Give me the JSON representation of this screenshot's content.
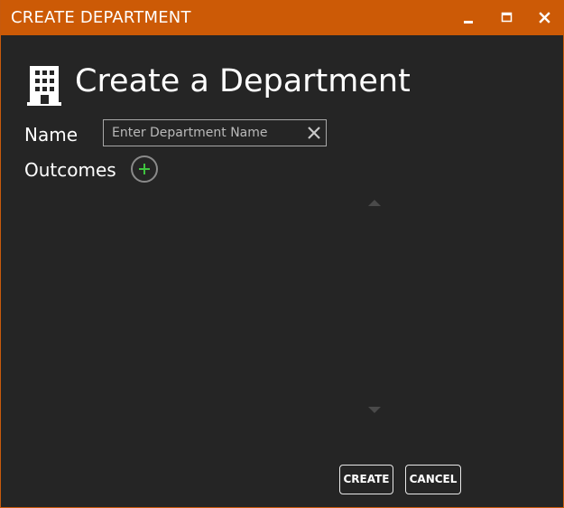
{
  "window": {
    "title": "CREATE DEPARTMENT",
    "accent_color": "#cc5a06",
    "background_color": "#252525",
    "controls": [
      "minimize-icon",
      "maximize-icon",
      "close-icon"
    ]
  },
  "header": {
    "title": "Create a Department",
    "icon": "building-icon"
  },
  "form": {
    "name_label": "Name",
    "name_input": {
      "value": "",
      "placeholder": "Enter Department Name",
      "clear_icon": "clear-icon"
    },
    "outcomes_label": "Outcomes",
    "add_outcome_icon": "plus-circle-icon",
    "add_outcome_color": "#3fc43f",
    "outcomes_list": {
      "items": [],
      "scroll_up_icon": "chevron-up-icon",
      "scroll_down_icon": "chevron-down-icon"
    }
  },
  "actions": {
    "create_label": "CREATE",
    "cancel_label": "CANCEL"
  }
}
